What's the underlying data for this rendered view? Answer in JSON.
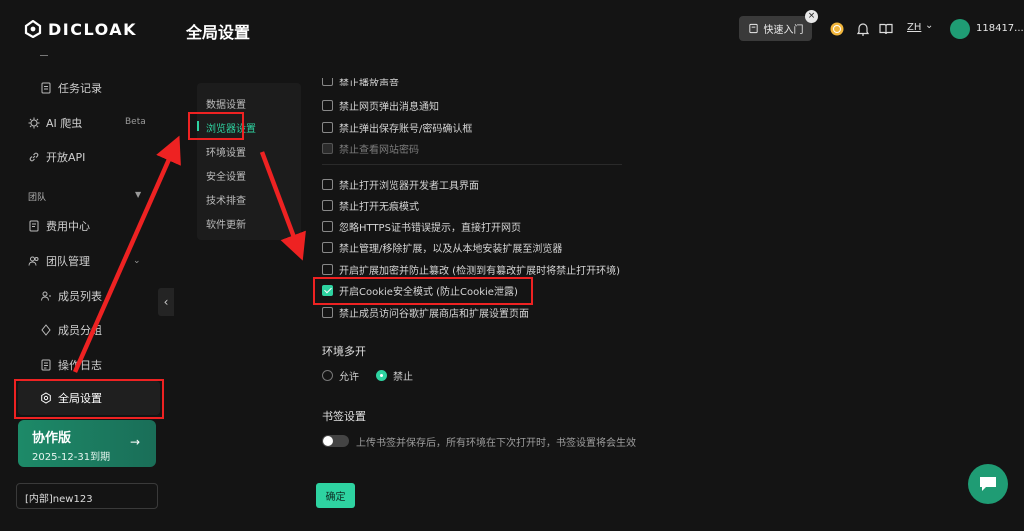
{
  "app": {
    "logo_text": "DICLOAK"
  },
  "sidebar": {
    "items": [
      {
        "label": "任务记录",
        "icon": "document-icon"
      },
      {
        "label": "AI 爬虫",
        "icon": "gear-bug-icon",
        "badge": "Beta"
      },
      {
        "label": "开放API",
        "icon": "link-icon"
      }
    ],
    "group_label": "团队",
    "team_items": [
      {
        "label": "费用中心",
        "icon": "billing-icon"
      },
      {
        "label": "团队管理",
        "icon": "users-icon"
      },
      {
        "label": "成员列表",
        "icon": "member-icon"
      },
      {
        "label": "成员分组",
        "icon": "group-icon"
      },
      {
        "label": "操作日志",
        "icon": "log-icon"
      }
    ],
    "active_item": {
      "label": "全局设置",
      "icon": "settings-icon"
    },
    "plan": {
      "name": "协作版",
      "expiry": "2025-12-31到期",
      "arrow": "→"
    },
    "team_select": "[内部]new123"
  },
  "header": {
    "title": "全局设置",
    "quick_entry": "快速入门",
    "quick_close": "×",
    "lang": "ZH",
    "username": "118417..."
  },
  "settings_nav": {
    "items": [
      "数据设置",
      "浏览器设置",
      "环境设置",
      "安全设置",
      "技术排查",
      "软件更新"
    ],
    "active_index": 1
  },
  "browser_settings": {
    "checkboxes": [
      {
        "label": "禁止播放声音",
        "checked": false,
        "disabled": false,
        "partial": true
      },
      {
        "label": "禁止网页弹出消息通知",
        "checked": false,
        "disabled": false
      },
      {
        "label": "禁止弹出保存账号/密码确认框",
        "checked": false,
        "disabled": false
      },
      {
        "label": "禁止查看网站密码",
        "checked": false,
        "disabled": true
      },
      {
        "label": "禁止打开浏览器开发者工具界面",
        "checked": false,
        "disabled": false
      },
      {
        "label": "禁止打开无痕模式",
        "checked": false,
        "disabled": false
      },
      {
        "label": "忽略HTTPS证书错误提示，直接打开网页",
        "checked": false,
        "disabled": false
      },
      {
        "label": "禁止管理/移除扩展，以及从本地安装扩展至浏览器",
        "checked": false,
        "disabled": false
      },
      {
        "label": "开启扩展加密并防止篡改 (检测到有篡改扩展时将禁止打开环境)",
        "checked": false,
        "disabled": false
      },
      {
        "label": "开启Cookie安全模式 (防止Cookie泄露)",
        "checked": true,
        "disabled": false
      },
      {
        "label": "禁止成员访问谷歌扩展商店和扩展设置页面",
        "checked": false,
        "disabled": false
      }
    ],
    "multi_open": {
      "title": "环境多开",
      "options": [
        "允许",
        "禁止"
      ],
      "selected": "禁止"
    },
    "bookmark": {
      "title": "书签设置",
      "toggle_text": "上传书签并保存后，所有环境在下次打开时，书签设置将会生效",
      "enabled": false
    },
    "confirm_label": "确定"
  },
  "colors": {
    "accent": "#2ed3a1",
    "annotation": "#ee2222",
    "background": "#141414"
  }
}
